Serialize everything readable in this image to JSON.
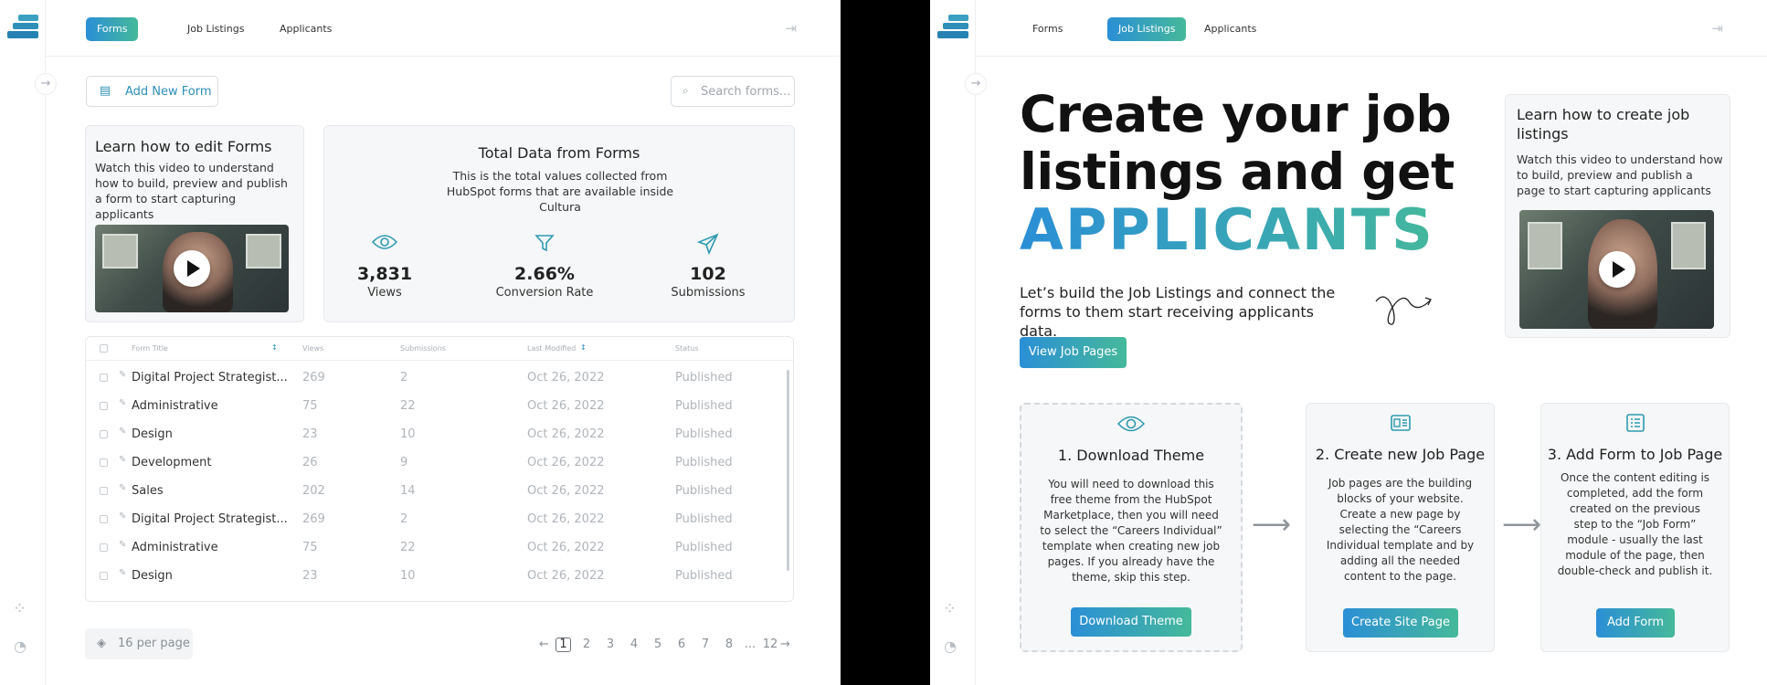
{
  "left": {
    "nav": {
      "tabs": [
        "Forms",
        "Job Listings",
        "Applicants"
      ],
      "active": "Forms"
    },
    "add_button": "Add New Form",
    "search_placeholder": "Search forms...",
    "learn": {
      "title": "Learn how to edit Forms",
      "desc": "Watch this video to understand how to build, preview and publish a form to start capturing applicants"
    },
    "total": {
      "title": "Total Data from Forms",
      "desc": "This is the total values collected from HubSpot forms that are available inside Cultura",
      "stats": [
        {
          "icon": "eye-icon",
          "value": "3,831",
          "label": "Views"
        },
        {
          "icon": "filter-icon",
          "value": "2.66%",
          "label": "Conversion Rate"
        },
        {
          "icon": "send-icon",
          "value": "102",
          "label": "Submissions"
        }
      ]
    },
    "table": {
      "headers": [
        "Form Title",
        "Views",
        "Submissions",
        "Last Modified",
        "Status"
      ],
      "rows": [
        {
          "title": "Digital Project Strategist...",
          "views": "269",
          "subs": "2",
          "date": "Oct 26, 2022",
          "status": "Published"
        },
        {
          "title": "Administrative",
          "views": "75",
          "subs": "22",
          "date": "Oct 26, 2022",
          "status": "Published"
        },
        {
          "title": "Design",
          "views": "23",
          "subs": "10",
          "date": "Oct 26, 2022",
          "status": "Published"
        },
        {
          "title": "Development",
          "views": "26",
          "subs": "9",
          "date": "Oct 26, 2022",
          "status": "Published"
        },
        {
          "title": "Sales",
          "views": "202",
          "subs": "14",
          "date": "Oct 26, 2022",
          "status": "Published"
        },
        {
          "title": "Digital Project Strategist...",
          "views": "269",
          "subs": "2",
          "date": "Oct 26, 2022",
          "status": "Published"
        },
        {
          "title": "Administrative",
          "views": "75",
          "subs": "22",
          "date": "Oct 26, 2022",
          "status": "Published"
        },
        {
          "title": "Design",
          "views": "23",
          "subs": "10",
          "date": "Oct 26, 2022",
          "status": "Published"
        }
      ]
    },
    "per_page": "16 per page",
    "pager": [
      "1",
      "2",
      "3",
      "4",
      "5",
      "6",
      "7",
      "8",
      "...",
      "12"
    ]
  },
  "right": {
    "nav": {
      "tabs": [
        "Forms",
        "Job Listings",
        "Applicants"
      ],
      "active": "Job Listings"
    },
    "hero": {
      "line1": "Create your job",
      "line2": "listings and get",
      "line3": "APPLICANTS"
    },
    "intro": "Let’s build the Job Listings and connect the forms to them start receiving applicants data.",
    "view_button": "View Job Pages",
    "learn": {
      "title": "Learn how to create job listings",
      "desc": "Watch this video to understand how to build, preview and publish a page to start capturing applicants"
    },
    "steps": [
      {
        "icon": "eye-icon",
        "title": "1. Download Theme",
        "desc": "You will need to download this free theme from the HubSpot Marketplace, then you will need to select the “Careers Individual” template when creating new job pages. If you already have the theme, skip this step.",
        "button": "Download Theme"
      },
      {
        "icon": "page-layout-icon",
        "title": "2. Create new Job Page",
        "desc": "Job pages are the building blocks of your website. Create a new page by selecting the “Careers Individual template and by adding all the needed content to the page.",
        "button": "Create Site Page"
      },
      {
        "icon": "form-icon",
        "title": "3. Add Form to Job Page",
        "desc": "Once the content editing is completed, add the form created on the previous step to the “Job Form” module - usually the last module of the page, then double-check and publish it.",
        "button": "Add Form"
      }
    ]
  },
  "colors": {
    "accent_start": "#2b8fd6",
    "accent_end": "#45b99a",
    "icon_teal": "#2e9ab0"
  }
}
